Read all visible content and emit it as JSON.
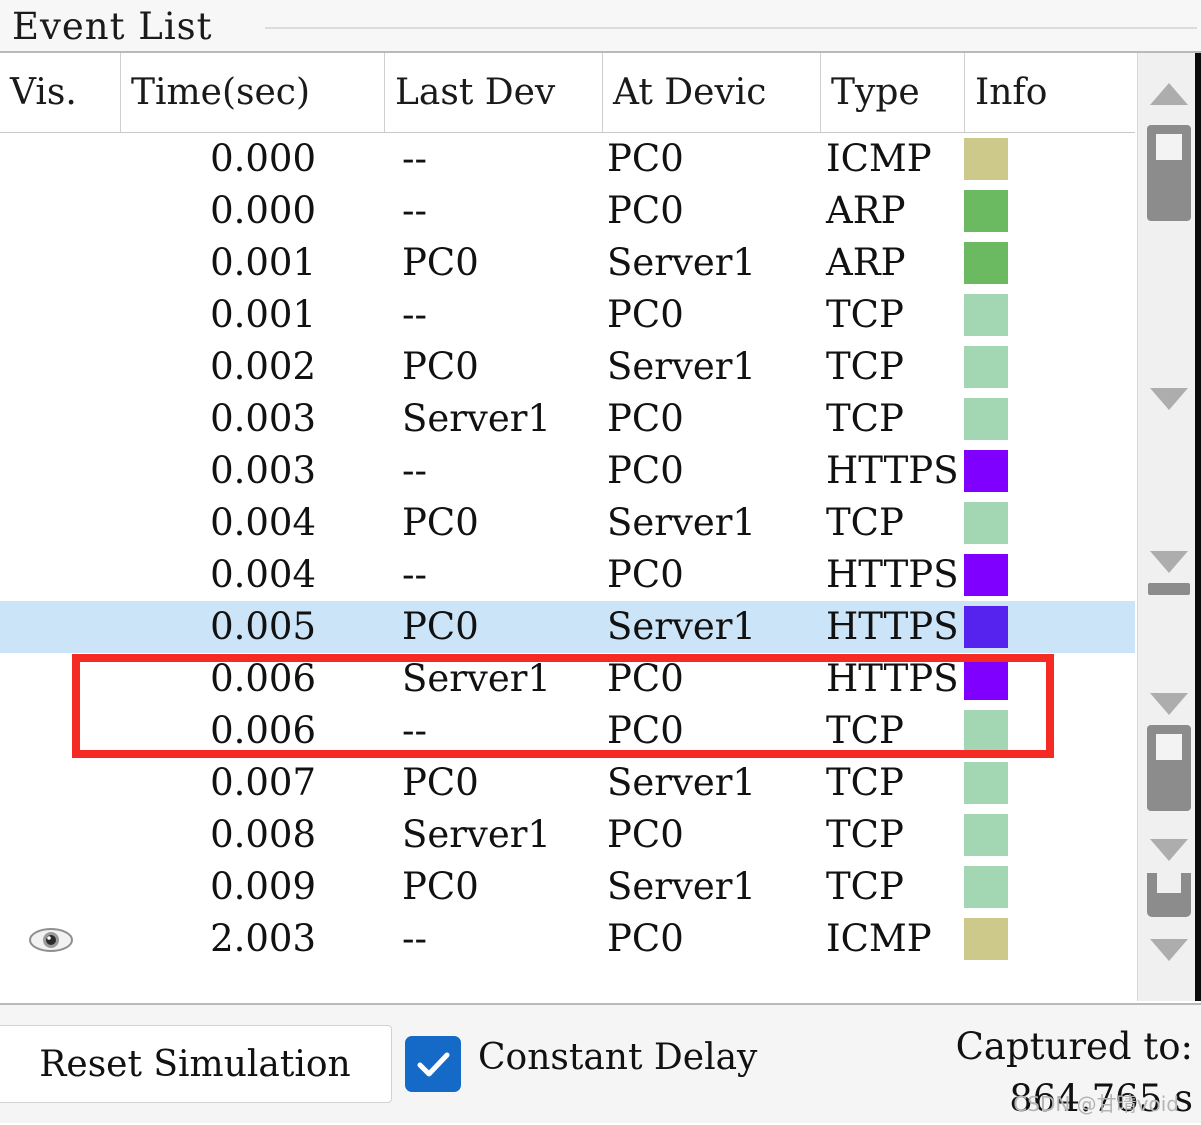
{
  "panel": {
    "title": "Event List"
  },
  "table": {
    "headers": [
      {
        "key": "vis",
        "label": "Vis."
      },
      {
        "key": "time",
        "label": "Time(sec)"
      },
      {
        "key": "last",
        "label": "Last Dev"
      },
      {
        "key": "at",
        "label": "At Devic"
      },
      {
        "key": "type",
        "label": "Type"
      },
      {
        "key": "info",
        "label": "Info"
      }
    ],
    "rows": [
      {
        "vis": "",
        "time": "0.000",
        "last": "--",
        "at": "PC0",
        "type": "ICMP",
        "color": "#ccc98a",
        "selected": false
      },
      {
        "vis": "",
        "time": "0.000",
        "last": "--",
        "at": "PC0",
        "type": "ARP",
        "color": "#6bb961",
        "selected": false
      },
      {
        "vis": "",
        "time": "0.001",
        "last": "PC0",
        "at": "Server1",
        "type": "ARP",
        "color": "#6bb961",
        "selected": false
      },
      {
        "vis": "",
        "time": "0.001",
        "last": "--",
        "at": "PC0",
        "type": "TCP",
        "color": "#a3d7b3",
        "selected": false
      },
      {
        "vis": "",
        "time": "0.002",
        "last": "PC0",
        "at": "Server1",
        "type": "TCP",
        "color": "#a3d7b3",
        "selected": false
      },
      {
        "vis": "",
        "time": "0.003",
        "last": "Server1",
        "at": "PC0",
        "type": "TCP",
        "color": "#a3d7b3",
        "selected": false
      },
      {
        "vis": "",
        "time": "0.003",
        "last": "--",
        "at": "PC0",
        "type": "HTTPS",
        "color": "#8000ff",
        "selected": false
      },
      {
        "vis": "",
        "time": "0.004",
        "last": "PC0",
        "at": "Server1",
        "type": "TCP",
        "color": "#a3d7b3",
        "selected": false
      },
      {
        "vis": "",
        "time": "0.004",
        "last": "--",
        "at": "PC0",
        "type": "HTTPS",
        "color": "#8000ff",
        "selected": false
      },
      {
        "vis": "",
        "time": "0.005",
        "last": "PC0",
        "at": "Server1",
        "type": "HTTPS",
        "color": "#5522ee",
        "selected": true
      },
      {
        "vis": "",
        "time": "0.006",
        "last": "Server1",
        "at": "PC0",
        "type": "HTTPS",
        "color": "#8000ff",
        "selected": false
      },
      {
        "vis": "",
        "time": "0.006",
        "last": "--",
        "at": "PC0",
        "type": "TCP",
        "color": "#a3d7b3",
        "selected": false
      },
      {
        "vis": "",
        "time": "0.007",
        "last": "PC0",
        "at": "Server1",
        "type": "TCP",
        "color": "#a3d7b3",
        "selected": false
      },
      {
        "vis": "",
        "time": "0.008",
        "last": "Server1",
        "at": "PC0",
        "type": "TCP",
        "color": "#a3d7b3",
        "selected": false
      },
      {
        "vis": "",
        "time": "0.009",
        "last": "PC0",
        "at": "Server1",
        "type": "TCP",
        "color": "#a3d7b3",
        "selected": false
      },
      {
        "vis": "eye",
        "time": "2.003",
        "last": "--",
        "at": "PC0",
        "type": "ICMP",
        "color": "#ccc98a",
        "selected": false
      }
    ]
  },
  "annotation": {
    "color": "#f52a22",
    "highlighted_rows": [
      "0.005",
      "0.006"
    ]
  },
  "scrollbar": {
    "up_arrow_icon": "triangle-up-icon",
    "down_arrow_icon": "triangle-down-icon",
    "thumb_icon": "scrollbar-thumb"
  },
  "toolbar": {
    "reset_label": "Reset Simulation",
    "constant_delay_label": "Constant Delay",
    "constant_delay_checked": true,
    "checkbox_color": "#1569c7",
    "captured_label": "Captured to:",
    "captured_value": "864.765 s"
  },
  "watermark": {
    "text": "CSDN @甘晴void"
  },
  "colors": {
    "selection": "#cce4f7",
    "icmp": "#ccc98a",
    "arp": "#6bb961",
    "tcp": "#a3d7b3",
    "https": "#8000ff",
    "https_selected": "#5522ee"
  }
}
